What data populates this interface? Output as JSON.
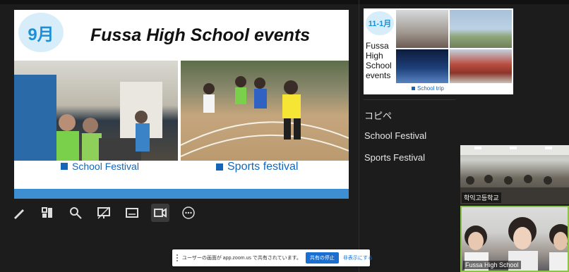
{
  "slide": {
    "month": "9月",
    "title": "Fussa High School events",
    "caption_left": "School Festival",
    "caption_right": "Sports festival"
  },
  "thumbnail": {
    "month": "11-1月",
    "text": "Fussa High School events",
    "caption": "School trip"
  },
  "sidebar": {
    "items": [
      "コピペ",
      "School Festival",
      "Sports Festival"
    ]
  },
  "toolbar": {
    "icons": [
      "pen-icon",
      "layout-icon",
      "search-icon",
      "screen-off-icon",
      "subtitles-icon",
      "camera-icon",
      "more-icon"
    ]
  },
  "videos": [
    {
      "label": "학익고등학교"
    },
    {
      "label": "Fussa High School"
    }
  ],
  "share_notice": {
    "message": "ユーザーの画面が app.zoom.us で共有されています。",
    "stop_label": "共有の停止",
    "hide_label": "非表示にする"
  },
  "colors": {
    "accent_blue": "#1666b8",
    "badge_bg": "#d7eefa",
    "footer_bar": "#3d8fd1",
    "active_speaker": "#8bc34a"
  }
}
